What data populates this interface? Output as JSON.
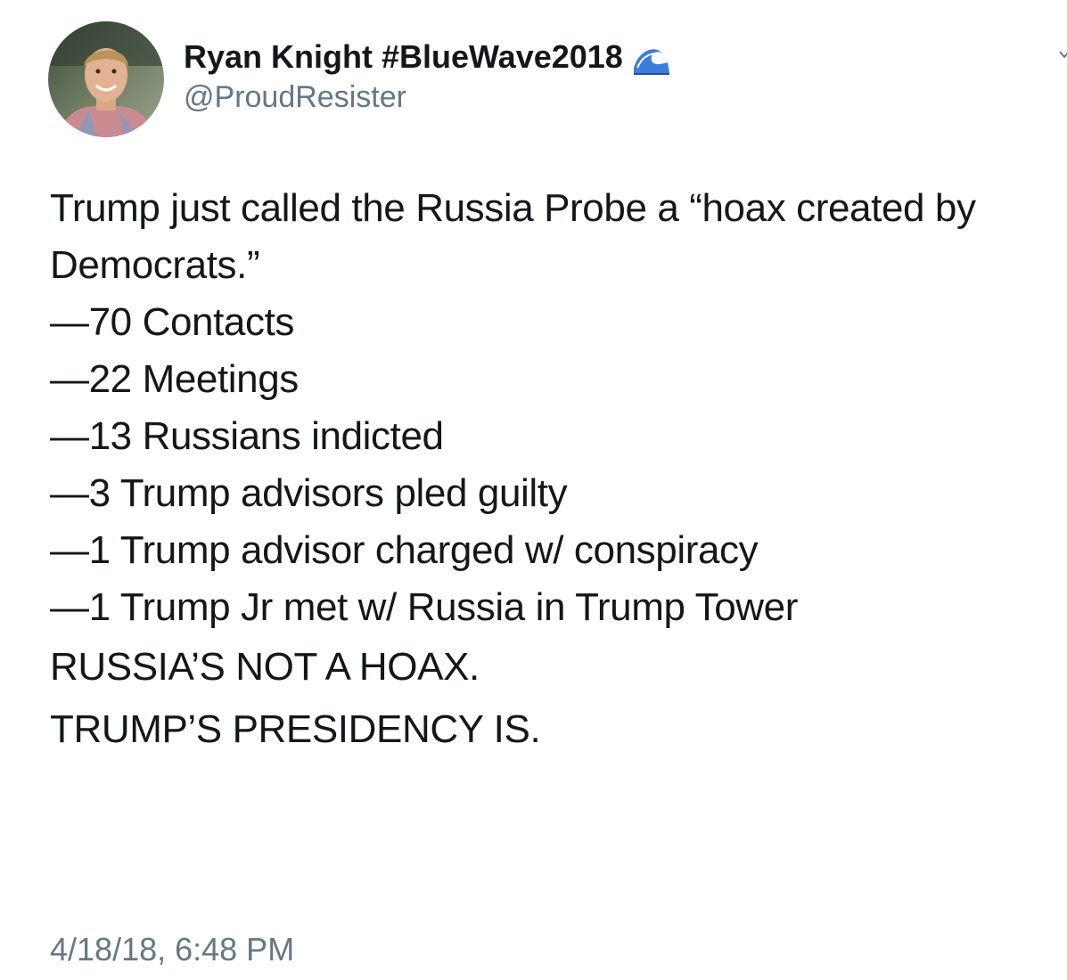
{
  "author": {
    "display_name": "Ryan Knight #BlueWave2018",
    "handle": "@ProudResister",
    "badge_icon": "water-wave-icon"
  },
  "tweet": {
    "intro": "Trump just called the Russia Probe a “hoax created by Democrats.”",
    "bullets": [
      "—70 Contacts",
      "—22 Meetings",
      "—13 Russians indicted",
      "—3 Trump advisors pled guilty",
      "—1 Trump advisor charged w/ conspiracy",
      "—1 Trump Jr met w/ Russia in Trump Tower"
    ],
    "outro": [
      "RUSSIA’S NOT A HOAX.",
      "TRUMP’S PRESIDENCY IS."
    ],
    "timestamp": "4/18/18, 6:48 PM"
  },
  "colors": {
    "text": "#14171a",
    "secondary": "#657786",
    "background": "#ffffff"
  }
}
